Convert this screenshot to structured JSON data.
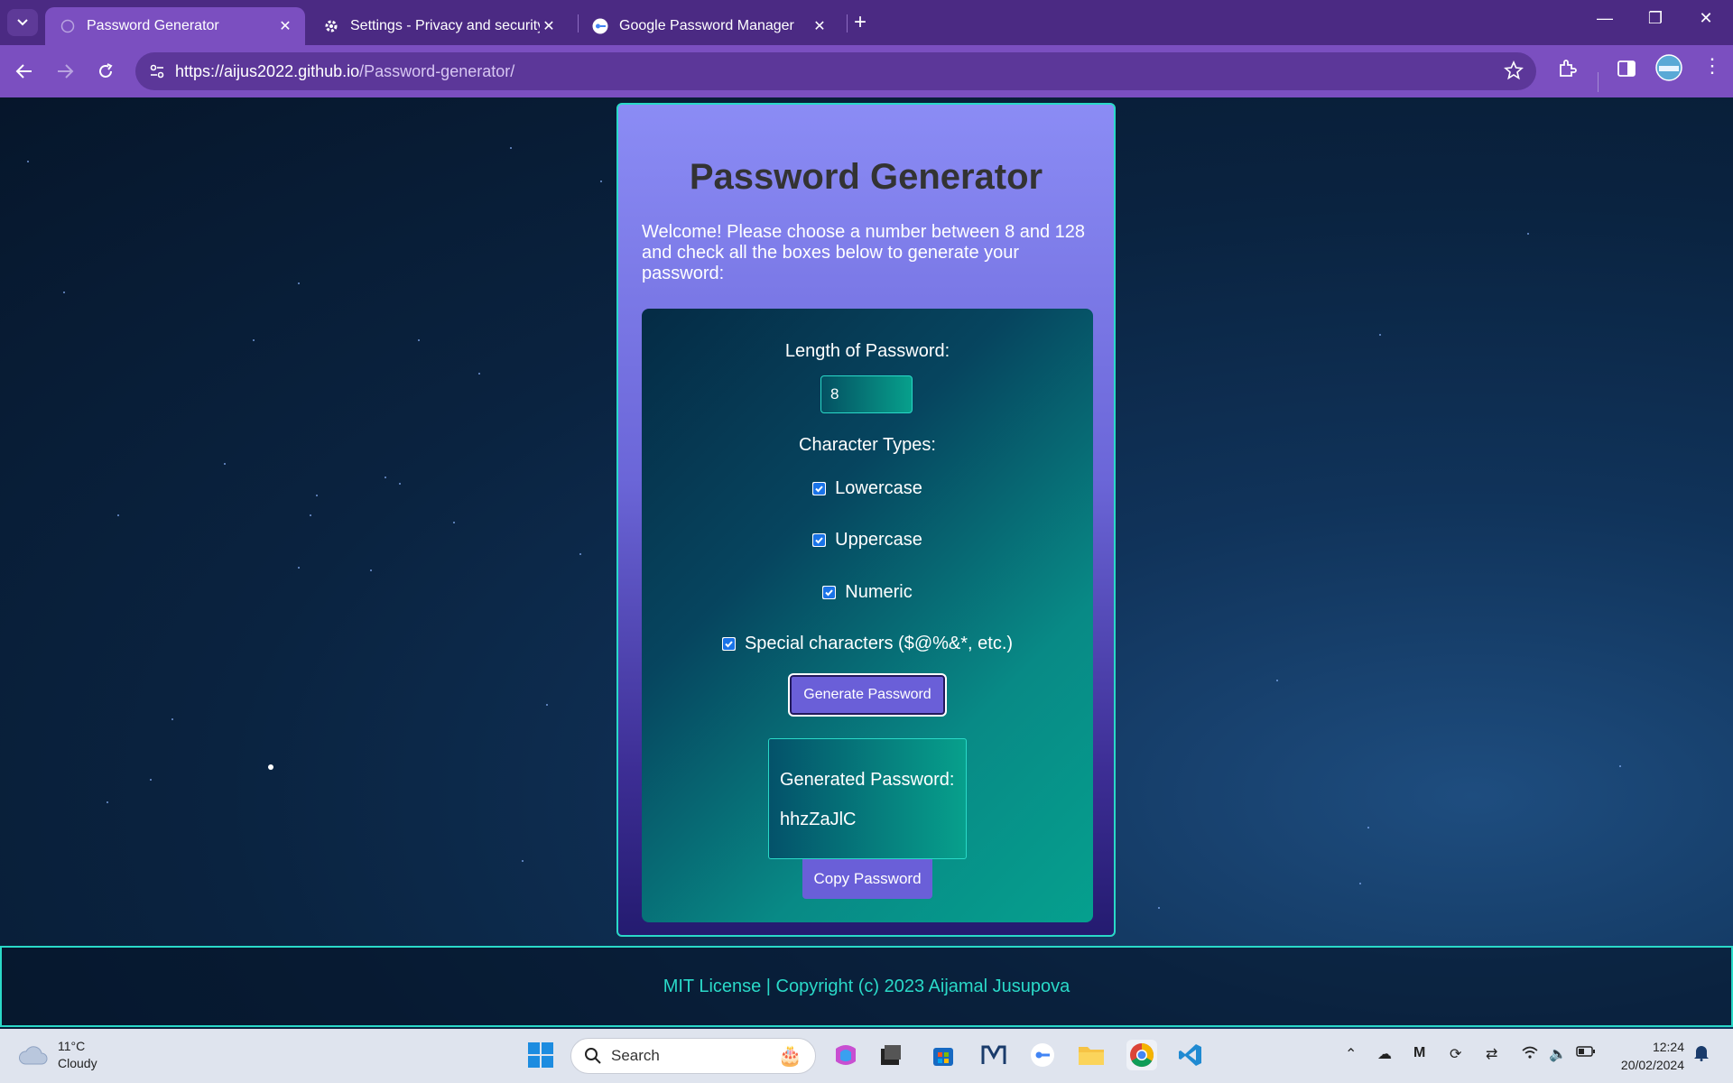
{
  "browser": {
    "tabs": [
      {
        "label": "Password Generator",
        "active": true
      },
      {
        "label": "Settings - Privacy and security",
        "active": false
      },
      {
        "label": "Google Password Manager",
        "active": false
      }
    ],
    "url_host": "https://aijus2022.github.io",
    "url_path": "/Password-generator/"
  },
  "page": {
    "title": "Password Generator",
    "welcome": "Welcome! Please choose a number between 8 and 128 and check all the boxes below to generate your password:",
    "length_label": "Length of Password:",
    "length_value": "8",
    "types_label": "Character Types:",
    "options": [
      {
        "label": "Lowercase",
        "checked": true
      },
      {
        "label": "Uppercase",
        "checked": true
      },
      {
        "label": "Numeric",
        "checked": true
      },
      {
        "label": "Special characters ($@%&*, etc.)",
        "checked": true
      }
    ],
    "generate_button": "Generate Password",
    "generated_label": "Generated Password:",
    "generated_value": "hhzZaJlC",
    "copy_button": "Copy Password",
    "footer": "MIT License | Copyright (c) 2023 Aijamal Jusupova"
  },
  "taskbar": {
    "weather_temp": "11°C",
    "weather_desc": "Cloudy",
    "search_placeholder": "Search",
    "time": "12:24",
    "date": "20/02/2024"
  },
  "colors": {
    "accent": "#2ad9c8",
    "chrome": "#7b4fc0",
    "button": "#6a5fd8"
  }
}
